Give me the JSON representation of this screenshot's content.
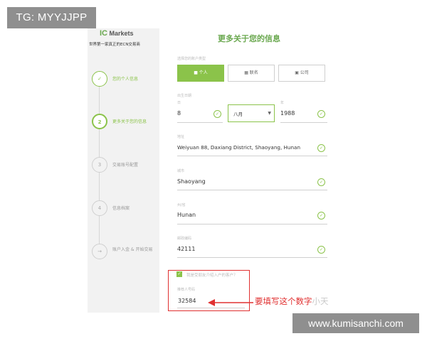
{
  "watermark_tag": "TG: MYYJJPP",
  "site_tag": "www.kumisanchi.com",
  "sidebar": {
    "logo_prefix": "IC",
    "logo_text": "Markets",
    "tagline": "世界第一家真正的ECN交易商",
    "steps": [
      {
        "number": "✓",
        "label": "您的个人信息"
      },
      {
        "number": "2",
        "label": "更多关于您的信息"
      },
      {
        "number": "3",
        "label": "交易账号配置"
      },
      {
        "number": "4",
        "label": "信息档案"
      },
      {
        "number": "→",
        "label": "账户入金 & 开始交易"
      }
    ]
  },
  "form": {
    "title": "更多关于您的信息",
    "account_type_label": "选择您的账户类型",
    "account_types": [
      {
        "icon": "person-icon",
        "label": "个人"
      },
      {
        "icon": "joint-icon",
        "label": "联名"
      },
      {
        "icon": "briefcase-icon",
        "label": "公司"
      }
    ],
    "dob": {
      "label": "出生日期",
      "day_label": "日",
      "day_value": "8",
      "month_value": "八月",
      "year_label": "年",
      "year_value": "1988"
    },
    "address": {
      "label": "地址",
      "value": "Weiyuan 88, Daxiang District, Shaoyang, Hunan"
    },
    "city": {
      "label": "城市",
      "value": "Shaoyang"
    },
    "province": {
      "label": "州/省",
      "value": "Hunan"
    },
    "postal": {
      "label": "邮政编码",
      "value": "42111"
    },
    "referral_checkbox_label": "我是受朋友介绍入户的客户？",
    "referrer": {
      "label": "推荐人号码",
      "value": "32584"
    }
  },
  "annotation": {
    "text": "要填写这个数字",
    "ghost_text": "小天"
  },
  "colors": {
    "accent": "#8bc34a",
    "annotation_red": "#e03030",
    "sidebar_bg": "#f2f2f2"
  }
}
